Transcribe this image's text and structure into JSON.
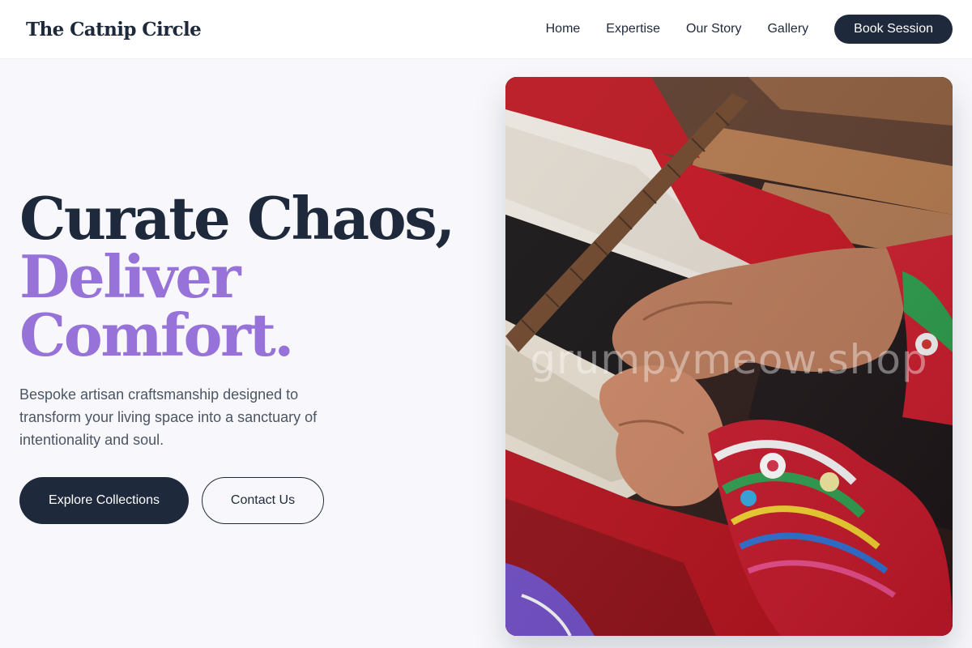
{
  "brand": {
    "name": "The Catnip Circle"
  },
  "nav": {
    "items": [
      {
        "label": "Home"
      },
      {
        "label": "Expertise"
      },
      {
        "label": "Our Story"
      },
      {
        "label": "Gallery"
      }
    ],
    "cta_label": "Book Session"
  },
  "hero": {
    "title_line1": "Curate Chaos,",
    "title_line2": "Deliver",
    "title_line3": "Comfort.",
    "description": "Bespoke artisan craftsmanship designed to transform your living space into a sanctuary of intentionality and soul.",
    "primary_button": "Explore Collections",
    "secondary_button": "Contact Us",
    "image_watermark": "grumpymeow.shop"
  },
  "colors": {
    "primary_dark": "#1e293b",
    "accent_purple": "#9672d9",
    "background": "#f8f8fc"
  }
}
